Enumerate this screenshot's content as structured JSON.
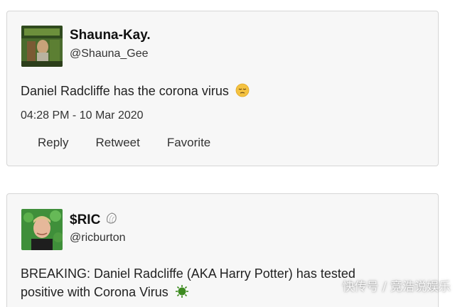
{
  "tweets": [
    {
      "display_name": "Shauna-Kay.",
      "handle": "@Shauna_Gee",
      "text": "Daniel Radcliffe has the corona virus",
      "text_emoji": "pensive-face-icon",
      "timestamp": "04:28 PM - 10 Mar 2020",
      "actions": {
        "reply": "Reply",
        "retweet": "Retweet",
        "favorite": "Favorite"
      }
    },
    {
      "display_name": "$RIC",
      "name_emoji": "shell-icon",
      "handle": "@ricburton",
      "text_line1": "BREAKING: Daniel Radcliffe (AKA Harry Potter) has tested",
      "text_line2": "positive with Corona Virus",
      "text_emoji": "virus-icon"
    }
  ],
  "watermark": "快传号 / 竞浩说娱乐",
  "colors": {
    "card_background": "#f7f7f7",
    "card_border": "#d6d6d6",
    "text": "#222222",
    "virus_green": "#3c8a1f"
  }
}
